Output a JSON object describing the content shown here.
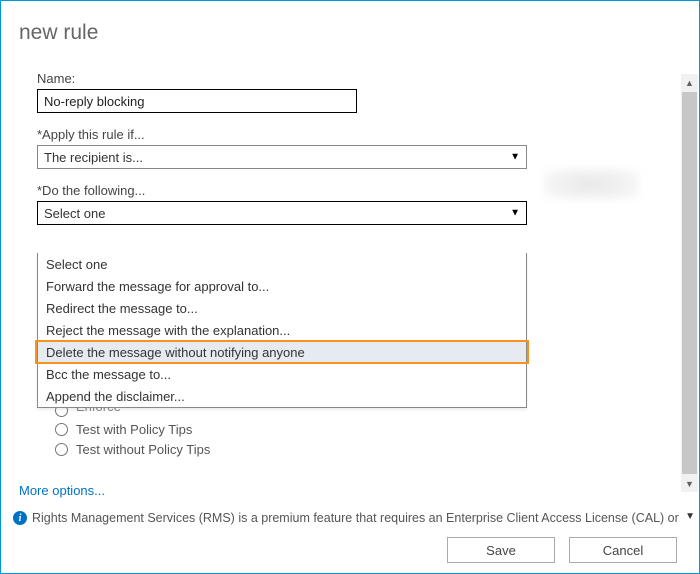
{
  "window_title": "new rule",
  "fields": {
    "name_label": "Name:",
    "name_value": "No-reply blocking",
    "apply_label": "*Apply this rule if...",
    "apply_selected": "The recipient is...",
    "action_label": "*Do the following...",
    "action_selected": "Select one"
  },
  "dropdown_options": [
    "Select one",
    "Forward the message for approval to...",
    "Redirect the message to...",
    "Reject the message with the explanation...",
    "Delete the message without notifying anyone",
    "Bcc the message to...",
    "Append the disclaimer..."
  ],
  "highlighted_option_index": 4,
  "radios": {
    "r0": "Enforce",
    "r1": "Test with Policy Tips",
    "r2": "Test without Policy Tips"
  },
  "more_options": "More options...",
  "info_text": "Rights Management Services (RMS) is a premium feature that requires an Enterprise Client Access License (CAL) or a RMS",
  "footer": {
    "save": "Save",
    "cancel": "Cancel"
  }
}
